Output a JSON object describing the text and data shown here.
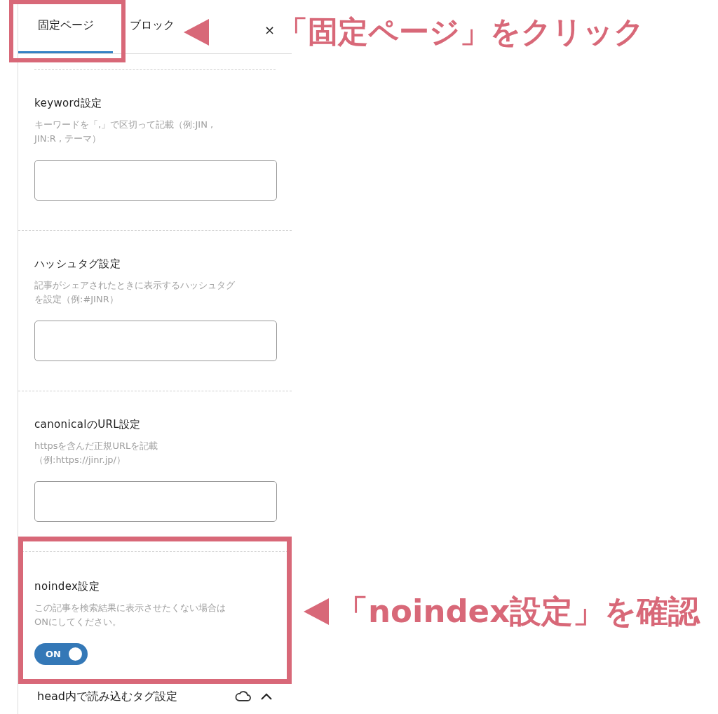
{
  "tabs": [
    {
      "label": "固定ページ",
      "selected": true
    },
    {
      "label": "ブロック",
      "selected": false
    }
  ],
  "close": "×",
  "sections": [
    {
      "kind": "text_field",
      "title": "keyword設定",
      "hint": [
        "キーワードを「,」で区切って記載（例:JIN ,",
        "JIN:R , テーマ）"
      ]
    },
    {
      "kind": "text_field",
      "title": "ハッシュタグ設定",
      "hint": [
        "記事がシェアされたときに表示するハッシュタグ",
        "を設定（例:#JINR）"
      ]
    },
    {
      "kind": "text_field",
      "title": "canonicalのURL設定",
      "hint": [
        "httpsを含んだ正規URLを記載",
        "（例:https://jinr.jp/）"
      ]
    },
    {
      "kind": "toggle",
      "title": "noindex設定",
      "hint": [
        "この記事を検索結果に表示させたくない場合は",
        "ONにしてください。"
      ],
      "toggle": {
        "label": "ON",
        "on": true
      }
    }
  ],
  "collapsed_panel": {
    "title": "head内で読み込むタグ設定",
    "expanded": true
  },
  "annotations": [
    {
      "text": "「固定ページ」をクリック"
    },
    {
      "text": "「noindex設定」を確認"
    }
  ]
}
